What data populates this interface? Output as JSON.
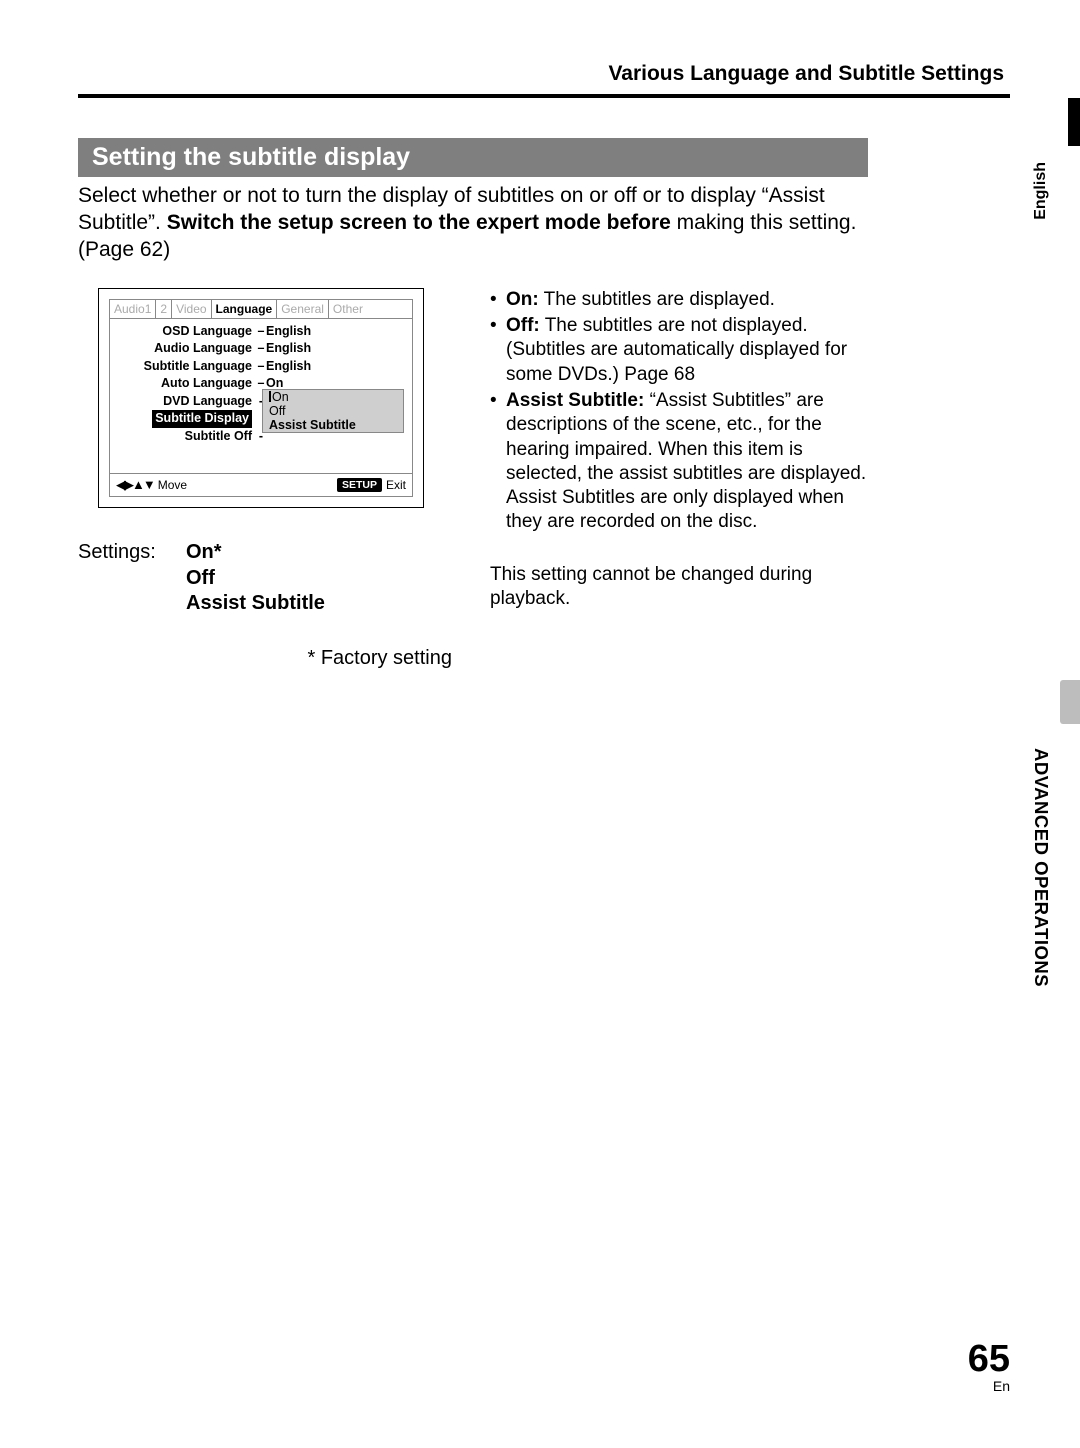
{
  "header": {
    "section": "Various Language and Subtitle Settings"
  },
  "side": {
    "language": "English",
    "chapter": "ADVANCED OPERATIONS"
  },
  "topic": {
    "title": "Setting the subtitle display",
    "intro_pre": "Select whether or not to turn the display of subtitles on or off or to display “Assist Subtitle”.  ",
    "intro_bold": "Switch the setup screen to the expert mode before",
    "intro_post": " making this setting.  (Page 62)"
  },
  "osd": {
    "tabs": [
      "Audio1",
      "2",
      "Video",
      "Language",
      "General",
      "Other"
    ],
    "rows": [
      {
        "label": "OSD Language",
        "value": "English"
      },
      {
        "label": "Audio Language",
        "value": "English"
      },
      {
        "label": "Subtitle Language",
        "value": "English"
      },
      {
        "label": "Auto Language",
        "value": "On"
      },
      {
        "label": "DVD Language",
        "value": "On",
        "cursor": true
      },
      {
        "label": "Subtitle Display",
        "value": "Off",
        "selected": true
      },
      {
        "label": "Subtitle Off",
        "value": "Assist Subtitle"
      }
    ],
    "popup": [
      "On",
      "Off",
      "Assist Subtitle"
    ],
    "footer": {
      "move": "Move",
      "setup": "SETUP",
      "exit": "Exit"
    }
  },
  "settings": {
    "label": "Settings:",
    "options": [
      "On*",
      "Off",
      "Assist Subtitle"
    ],
    "factory": "* Factory setting"
  },
  "bullets": {
    "on": {
      "lead": "On:",
      "text": "  The subtitles are displayed."
    },
    "off": {
      "lead": "Off:",
      "text": "  The subtitles are not displayed.  (Subtitles are automatically displayed for some DVDs.)  Page 68"
    },
    "assist": {
      "lead": "Assist Subtitle:",
      "text": "  “Assist Subtitles” are descriptions of the scene, etc., for the hearing impaired.  When this item is selected, the assist subtitles are displayed.  Assist Subtitles are only displayed when they are recorded on the disc."
    }
  },
  "note": "This setting cannot be changed during playback.",
  "footer": {
    "page": "65",
    "lang": "En"
  }
}
